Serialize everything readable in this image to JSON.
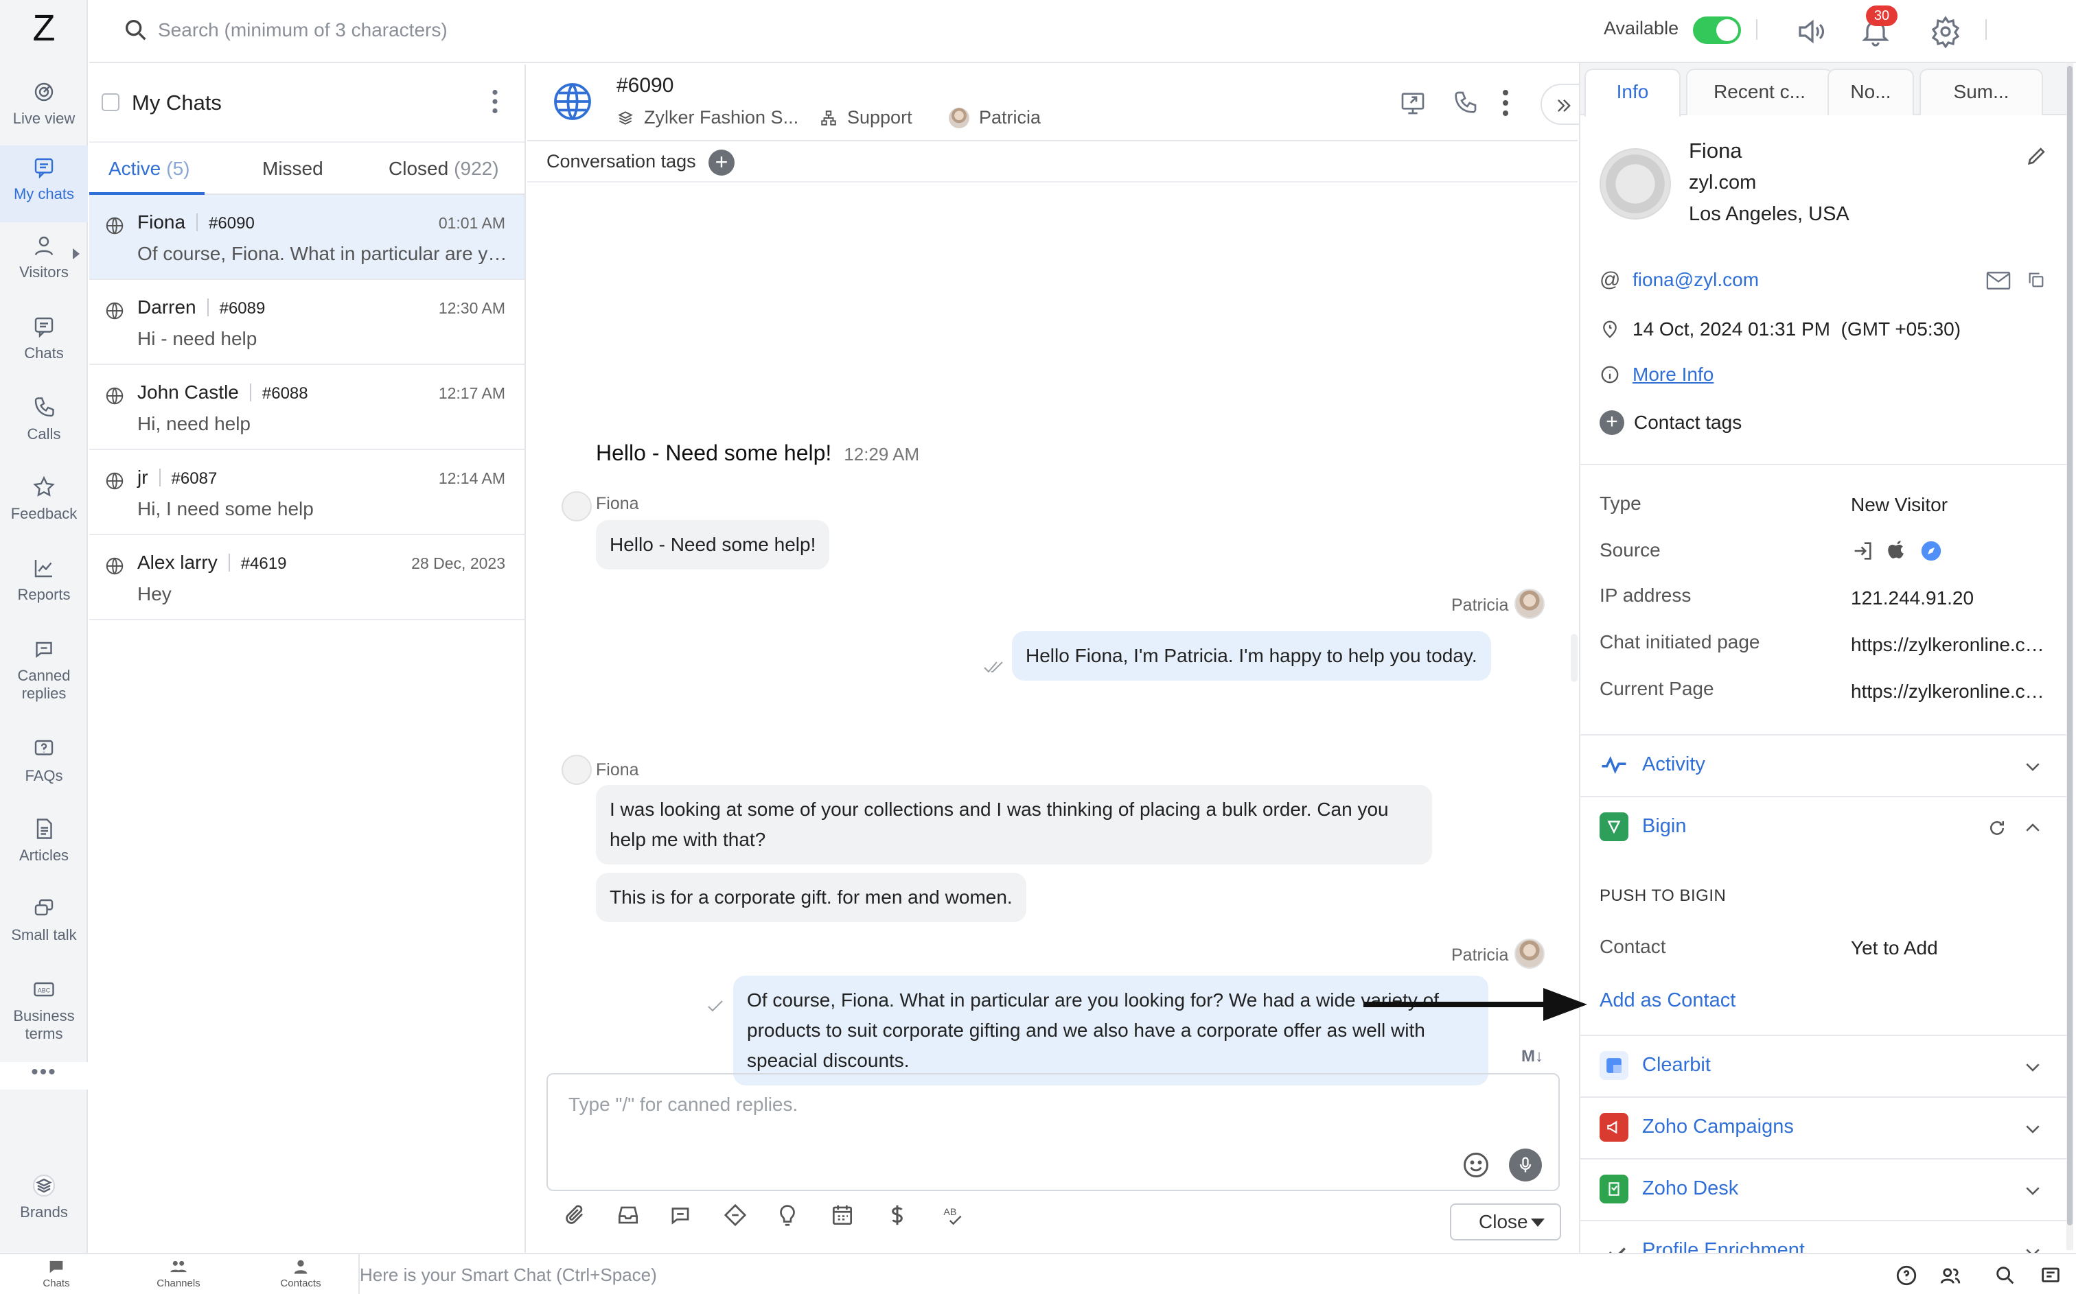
{
  "app": {
    "logo": "Z"
  },
  "nav": {
    "items": [
      {
        "id": "live-view",
        "label": "Live view",
        "icon": "radar-icon"
      },
      {
        "id": "my-chats",
        "label": "My chats",
        "icon": "chat-bubble-icon",
        "active": true
      },
      {
        "id": "visitors",
        "label": "Visitors",
        "icon": "person-icon"
      },
      {
        "id": "chats",
        "label": "Chats",
        "icon": "chat-bubble-icon"
      },
      {
        "id": "calls",
        "label": "Calls",
        "icon": "phone-icon"
      },
      {
        "id": "feedback",
        "label": "Feedback",
        "icon": "star-icon"
      },
      {
        "id": "reports",
        "label": "Reports",
        "icon": "chart-icon"
      },
      {
        "id": "canned-replies",
        "label": "Canned replies",
        "icon": "canned-icon"
      },
      {
        "id": "faqs",
        "label": "FAQs",
        "icon": "faq-icon"
      },
      {
        "id": "articles",
        "label": "Articles",
        "icon": "document-icon"
      },
      {
        "id": "small-talk",
        "label": "Small talk",
        "icon": "small-talk-icon"
      },
      {
        "id": "business-terms",
        "label": "Business terms",
        "icon": "abc-icon"
      }
    ],
    "more": "•••",
    "brands": "Brands"
  },
  "topbar": {
    "search_placeholder": "Search (minimum of 3 characters)",
    "availability_label": "Available",
    "availability_on": true,
    "notification_count": "30"
  },
  "chatlist": {
    "title": "My Chats",
    "tabs": [
      {
        "label": "Active",
        "count": "(5)",
        "active": true
      },
      {
        "label": "Missed",
        "count": ""
      },
      {
        "label": "Closed",
        "count": "(922)"
      }
    ],
    "rows": [
      {
        "name": "Fiona",
        "number": "#6090",
        "time": "01:01 AM",
        "preview": "Of course, Fiona. What in particular are you looking for?",
        "selected": true
      },
      {
        "name": "Darren",
        "number": "#6089",
        "time": "12:30 AM",
        "preview": "Hi - need help"
      },
      {
        "name": "John Castle",
        "number": "#6088",
        "time": "12:17 AM",
        "preview": "Hi, need help"
      },
      {
        "name": "jr",
        "number": "#6087",
        "time": "12:14 AM",
        "preview": "Hi, I need some help"
      },
      {
        "name": "Alex larry",
        "number": "#4619",
        "time": "28 Dec, 2023",
        "preview": "Hey"
      }
    ]
  },
  "conversation": {
    "id": "#6090",
    "department": "Zylker Fashion S...",
    "channel": "Support",
    "agent": "Patricia",
    "tags_label": "Conversation tags",
    "tags_add": "+",
    "first_message": {
      "text": "Hello - Need some help!",
      "time": "12:29 AM"
    },
    "messages": [
      {
        "sender": "Fiona",
        "direction": "in",
        "lines": [
          "Hello - Need some help!"
        ]
      },
      {
        "sender": "Patricia",
        "direction": "out",
        "lines": [
          "Hello Fiona, I'm Patricia. I'm happy to help you today."
        ]
      },
      {
        "sender": "Fiona",
        "direction": "in",
        "lines": [
          "I was looking at some of your collections and I was thinking of placing a bulk order. Can you help me with that?",
          "This is for a corporate gift. for men and women."
        ]
      },
      {
        "sender": "Patricia",
        "direction": "out",
        "lines": [
          "Of course, Fiona. What in particular are you looking for? We had a wide variety of products to suit corporate gifting and we also have a corporate offer as well with speacial discounts."
        ]
      }
    ],
    "markdown_label": "M↓",
    "composer_placeholder": "Type \"/\" for canned replies.",
    "close_button": "Close"
  },
  "info_panel": {
    "tabs": [
      "Info",
      "Recent c...",
      "No...",
      "Sum..."
    ],
    "contact": {
      "name": "Fiona",
      "website": "zyl.com",
      "location": "Los Angeles, USA",
      "email": "fiona@zyl.com",
      "datetime": "14 Oct, 2024 01:31 PM  (GMT +05:30)",
      "more_info": "More Info",
      "tags_label": "Contact tags"
    },
    "details": [
      {
        "key": "Type",
        "value": "New Visitor"
      },
      {
        "key": "Source",
        "value": ""
      },
      {
        "key": "IP address",
        "value": "121.244.91.20"
      },
      {
        "key": "Chat initiated page",
        "value": "https://zylkeronline.com"
      },
      {
        "key": "Current Page",
        "value": "https://zylkeronline.com"
      }
    ],
    "sections": {
      "activity": "Activity",
      "bigin": "Bigin",
      "push_label": "PUSH TO BIGIN",
      "contact_key": "Contact",
      "contact_value": "Yet to Add",
      "add_contact": "Add as Contact",
      "clearbit": "Clearbit",
      "zoho_campaigns": "Zoho Campaigns",
      "zoho_desk": "Zoho Desk",
      "profile_enrichment": "Profile Enrichment"
    }
  },
  "bottombar": {
    "items": [
      "Chats",
      "Channels",
      "Contacts"
    ],
    "smart_placeholder": "Here is your Smart Chat (Ctrl+Space)"
  },
  "colors": {
    "accent": "#2f6fd6",
    "available": "#34c759",
    "badge": "#e53935",
    "bigin": "#2e9e5b",
    "clearbit": "#4f8ff7",
    "zoho_campaigns": "#d93b30",
    "zoho_desk": "#2ea44f"
  }
}
